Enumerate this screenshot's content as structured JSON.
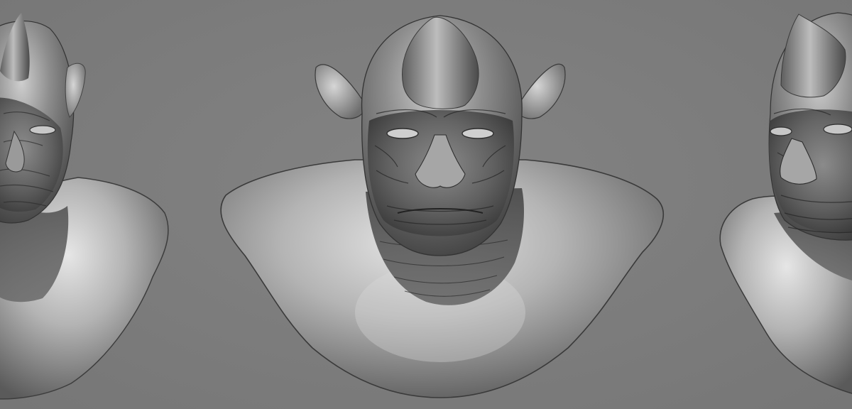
{
  "scene": {
    "background_color": "#7d7d7d",
    "material_light": "#e2e2e2",
    "material_mid": "#9a9a9a",
    "material_dark": "#3a3a3a",
    "views": [
      {
        "name": "three-quarter-left",
        "icon": "sculpt-bust-left"
      },
      {
        "name": "front",
        "icon": "sculpt-bust-front"
      },
      {
        "name": "three-quarter-right",
        "icon": "sculpt-bust-right"
      }
    ]
  }
}
